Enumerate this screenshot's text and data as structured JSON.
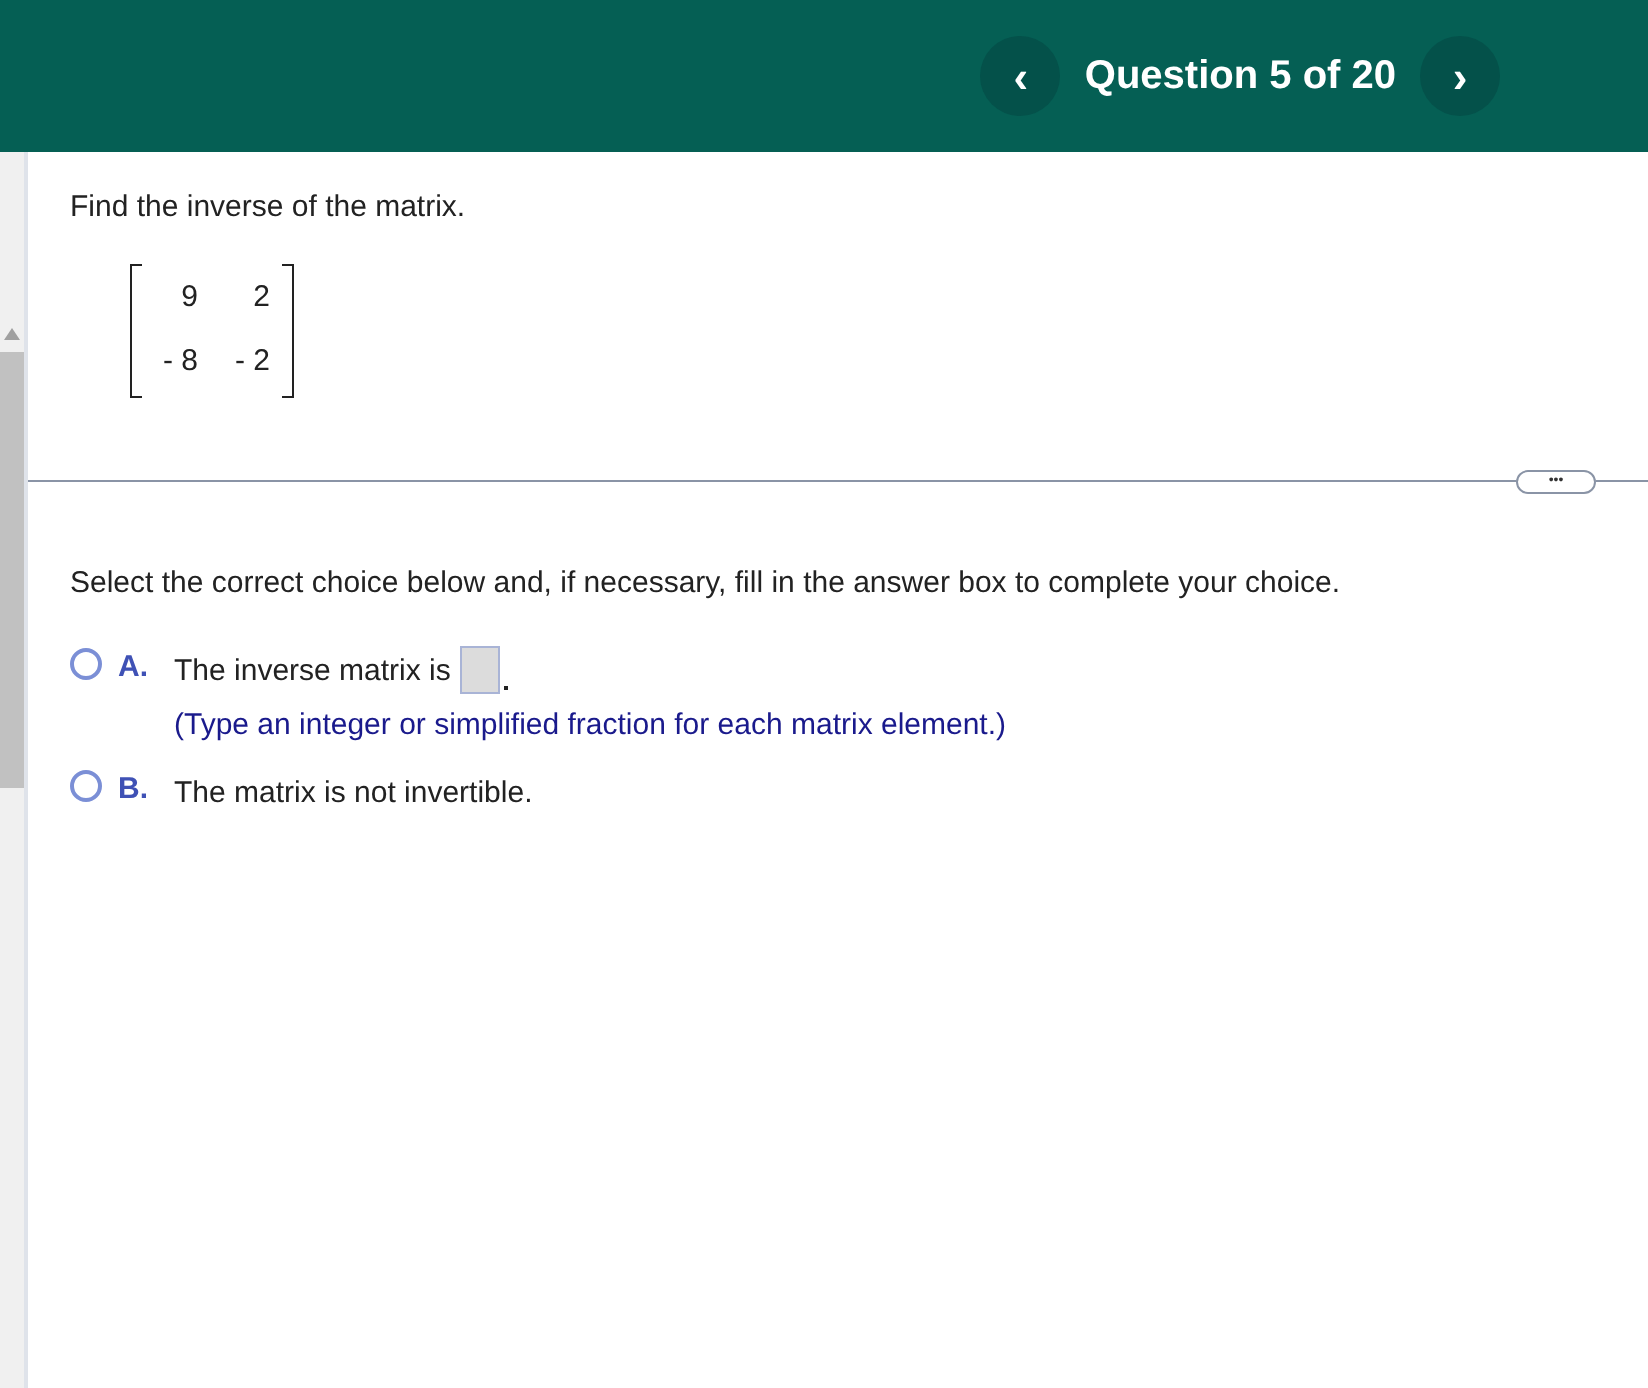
{
  "header": {
    "prev": "‹",
    "title": "Question 5 of 20",
    "next": "›"
  },
  "question": {
    "prompt": "Find the inverse of the matrix.",
    "matrix": [
      [
        "9",
        "2"
      ],
      [
        "- 8",
        "- 2"
      ]
    ]
  },
  "more_button": "•••",
  "instruction": "Select the correct choice below and, if necessary, fill in the answer box to complete your choice.",
  "choices": [
    {
      "letter": "A.",
      "text": "The inverse matrix is",
      "has_answer_box": true,
      "hint": "(Type an integer or simplified fraction for each matrix element.)",
      "selected": false
    },
    {
      "letter": "B.",
      "text": "The matrix is not invertible.",
      "has_answer_box": false,
      "selected": false
    }
  ]
}
